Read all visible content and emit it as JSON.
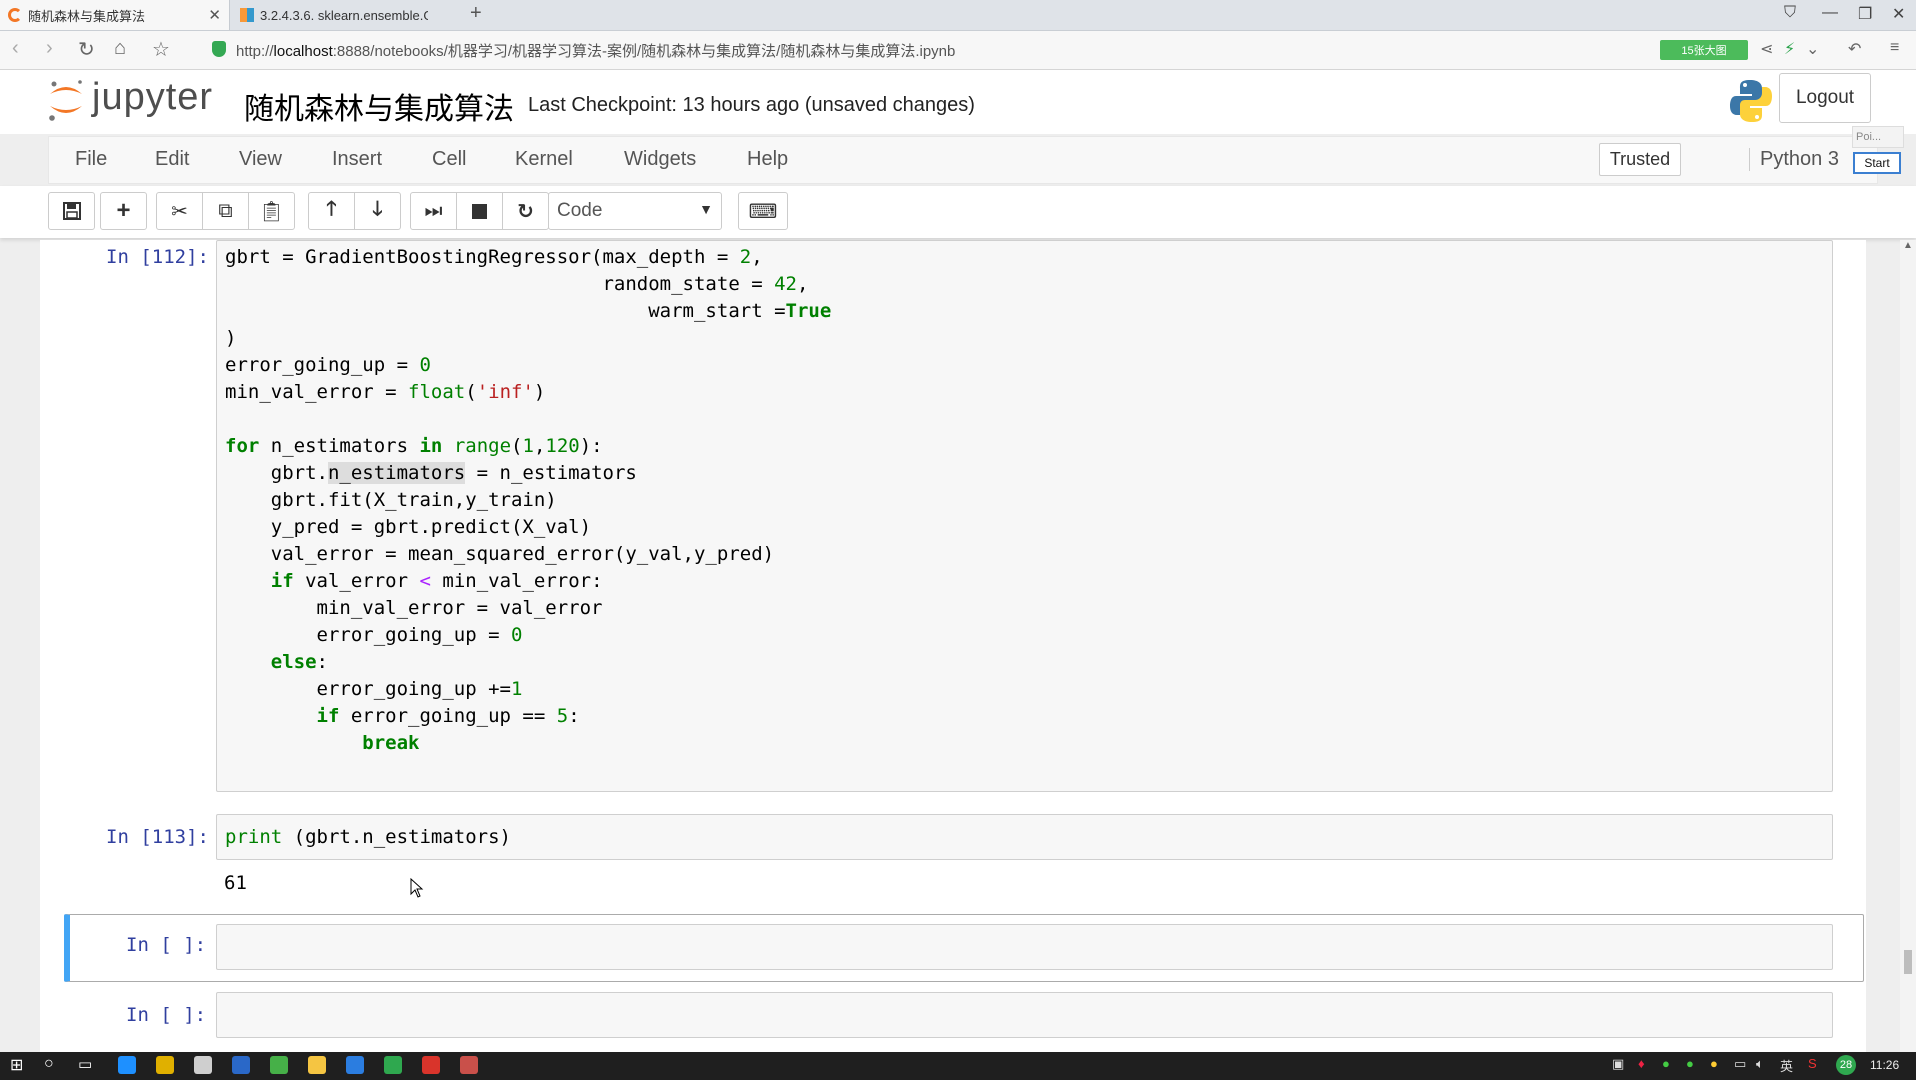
{
  "browser": {
    "tabs": [
      {
        "label": "随机森林与集成算法"
      },
      {
        "label": "3.2.4.3.6. sklearn.ensemble.Gr"
      }
    ],
    "url_prefix": "http://",
    "url_host": "localhost",
    "url_path": ":8888/notebooks/机器学习/机器学习算法-案例/随机森林与集成算法/随机森林与集成算法.ipynb",
    "badge": "15张大图"
  },
  "jupyter": {
    "logo_text": "jupyter",
    "notebook_title": "随机森林与集成算法",
    "checkpoint": "Last Checkpoint: 13 hours ago (unsaved changes)",
    "logout_label": "Logout",
    "trusted_label": "Trusted",
    "kernel_name": "Python 3",
    "start_label": "Start",
    "poi_label": "Poi..."
  },
  "menu": {
    "items": [
      "File",
      "Edit",
      "View",
      "Insert",
      "Cell",
      "Kernel",
      "Widgets",
      "Help"
    ]
  },
  "toolbar": {
    "cell_type": "Code",
    "icons": [
      "save-icon",
      "plus-icon",
      "cut-icon",
      "copy-icon",
      "paste-icon",
      "arrow-up-icon",
      "arrow-down-icon",
      "run-icon",
      "stop-icon",
      "restart-icon",
      "keyboard-icon"
    ]
  },
  "cells": [
    {
      "prompt": "In [112]:"
    },
    {
      "prompt": "In [113]:",
      "output": "61"
    },
    {
      "prompt": "In [ ]:"
    },
    {
      "prompt": "In [ ]:"
    }
  ],
  "taskbar": {
    "clock": "11:26",
    "ime": "英",
    "badge_num": "28"
  }
}
